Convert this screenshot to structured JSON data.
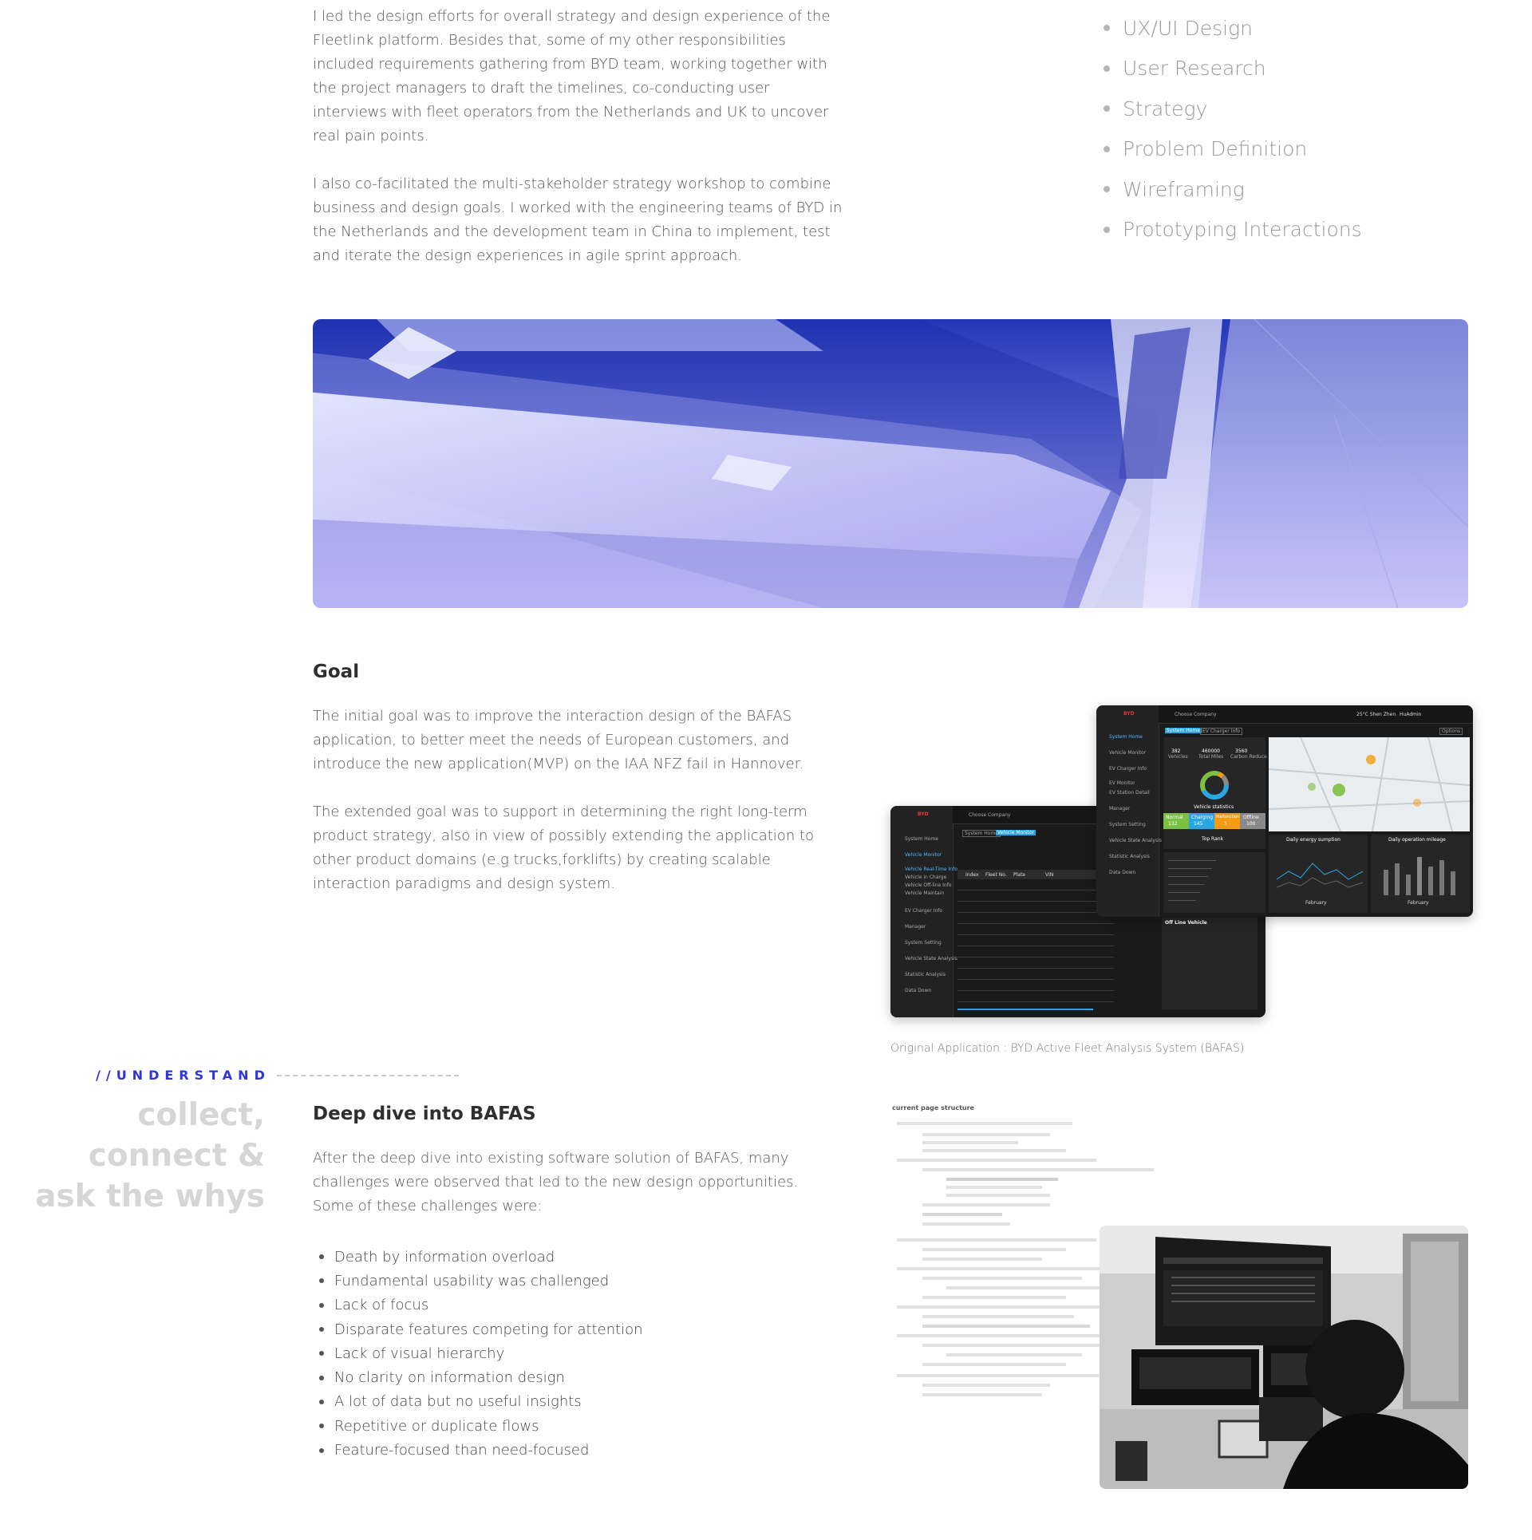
{
  "intro": {
    "paragraph_1": "I led the design efforts for overall strategy and design experience of the Fleetlink platform. Besides that, some of my other responsibilities included requirements gathering from BYD team, working together with the project managers to draft the timelines, co-conducting user interviews with fleet operators from the Netherlands and UK to uncover real pain points.",
    "paragraph_2": "I also co-facilitated the multi-stakeholder strategy workshop to combine business and design goals. I worked with the engineering teams of BYD in the Netherlands and the development team in China to implement, test and iterate the design experiences in agile sprint approach."
  },
  "skills": [
    "UX/UI Design",
    "User Research",
    "Strategy",
    "Problem Definition",
    "Wireframing",
    "Prototyping Interactions"
  ],
  "goal": {
    "title": "Goal",
    "paragraph_1": "The initial goal was to improve the interaction design of the BAFAS application, to better meet the needs of European customers, and introduce the new application(MVP) on the IAA NFZ fail in Hannover.",
    "paragraph_2": "The extended goal was to support in determining the right long-term product strategy, also in view of possibly extending the application to other product domains (e.g trucks,forklifts) by creating scalable interaction paradigms and design system.",
    "caption": "Original Application : BYD Active Fleet Analysis System (BAFAS)"
  },
  "understand": {
    "label": "//UNDERSTAND",
    "tagline_1": "collect,",
    "tagline_2": "connect &",
    "tagline_3": "ask the whys"
  },
  "deep_dive": {
    "title": "Deep dive into BAFAS",
    "paragraph": "After the deep dive into existing software solution of BAFAS, many challenges were observed that led to the new design opportunities. Some of these challenges were:",
    "challenges": [
      "Death by information overload",
      "Fundamental usability was challenged",
      "Lack of focus",
      "Disparate features competing for attention",
      "Lack of visual hierarchy",
      "No clarity on information design",
      "A lot of data but no useful insights",
      "Repetitive or duplicate flows",
      "Feature-focused than need-focused"
    ],
    "sheet_title": "current page structure"
  },
  "mockup": {
    "back": {
      "company": "Choose Company",
      "crumb_1": "System Home",
      "crumb_2": "Vehicle Monitor",
      "menu": [
        "System Home",
        "Vehicle Monitor",
        "Vehicle Real-Time Info",
        "Vehicle in Charge",
        "Vehicle Off-line Info",
        "Vehicle Maintain",
        "EV Charger Info",
        "Manager",
        "System Setting",
        "Vehicle State Analysis",
        "Statistic Analysis",
        "Data Down"
      ],
      "columns": [
        "Index",
        "Fleet No.",
        "Plate",
        "VIN"
      ]
    },
    "front": {
      "company": "Choose Company",
      "location": "25°C Shen Zhen",
      "user": "HuAdmin",
      "crumb_1": "System Home",
      "crumb_2": "EV Charger Info",
      "menu": [
        "System Home",
        "Vehicle Monitor",
        "EV Charger Info",
        "EV Monitor",
        "EV Station Detail",
        "Manager",
        "System Setting",
        "Vehicle State Analysis",
        "Statistic Analysis",
        "Data Down"
      ],
      "stats": [
        {
          "value": "382",
          "label": "Vehicles"
        },
        {
          "value": "460000",
          "label": "Total Miles"
        },
        {
          "value": "3560",
          "label": "Carbon Reduce"
        }
      ],
      "vehicle_stats_title": "Vehicle statistics",
      "status": [
        {
          "label": "Normal",
          "value": "132",
          "color": "#7bc043"
        },
        {
          "label": "Charging",
          "value": "145",
          "color": "#2aa7e0"
        },
        {
          "label": "Malfunction",
          "value": "5",
          "color": "#f39c12"
        },
        {
          "label": "Offline",
          "value": "100",
          "color": "#8a8a8a"
        }
      ],
      "top_rank_title": "Top Rank",
      "energy_title": "Daily energy sumption",
      "mileage_title": "Daily operation mileage",
      "month": "February",
      "offline_title": "Off Line Vehicle",
      "options": "Options"
    }
  },
  "colors": {
    "accent": "#2d35e0",
    "hero_top": "#1d2db0",
    "hero_bottom": "#c9b8ff"
  }
}
